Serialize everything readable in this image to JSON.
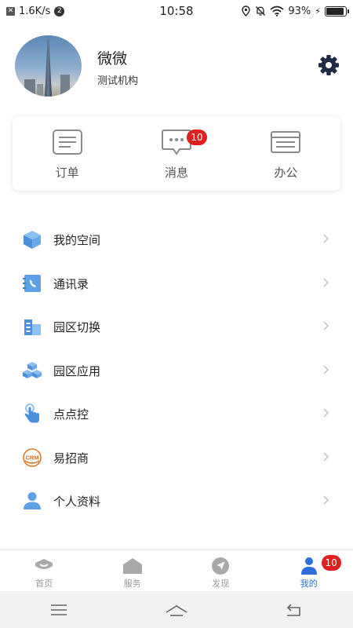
{
  "status_bar": {
    "network_speed": "1.6K/s",
    "notification_count": "2",
    "time": "10:58",
    "battery_percent": "93%",
    "battery_level": 0.93
  },
  "profile": {
    "name": "微微",
    "organization": "测试机构"
  },
  "shortcuts": [
    {
      "label": "订单",
      "icon": "order-icon"
    },
    {
      "label": "消息",
      "icon": "message-icon",
      "badge": "10"
    },
    {
      "label": "办公",
      "icon": "office-icon"
    }
  ],
  "menu": {
    "items": [
      {
        "label": "我的空间",
        "icon": "cube-icon"
      },
      {
        "label": "通讯录",
        "icon": "contacts-icon"
      },
      {
        "label": "园区切换",
        "icon": "building-icon"
      },
      {
        "label": "园区应用",
        "icon": "boxes-icon"
      },
      {
        "label": "点点控",
        "icon": "touch-icon"
      },
      {
        "label": "易招商",
        "icon": "crm-icon",
        "icon_text": "CRM"
      },
      {
        "label": "个人资料",
        "icon": "person-icon"
      }
    ]
  },
  "bottom_nav": {
    "items": [
      {
        "label": "首页",
        "icon": "home-icon"
      },
      {
        "label": "服务",
        "icon": "service-icon"
      },
      {
        "label": "发现",
        "icon": "compass-icon"
      },
      {
        "label": "我的",
        "icon": "profile-icon",
        "badge": "10",
        "active": true
      }
    ]
  },
  "colors": {
    "accent": "#2a6fdb",
    "menu_icon": "#5da0e6",
    "badge": "#e02020",
    "settings_icon": "#1f2a44"
  }
}
